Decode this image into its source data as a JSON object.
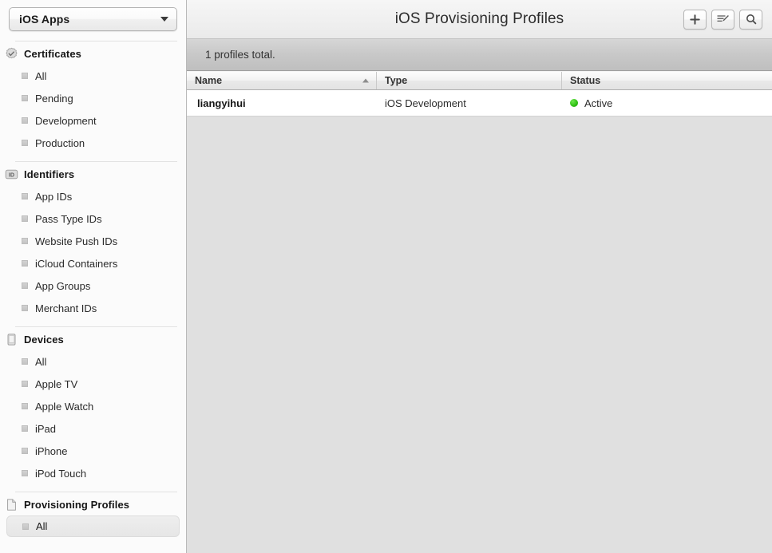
{
  "sidebar": {
    "team_picker": {
      "label": "iOS Apps",
      "chevron_icon": "chevron-down-icon"
    },
    "sections": [
      {
        "id": "certificates",
        "title": "Certificates",
        "icon": "certificate-seal-icon",
        "items": [
          {
            "label": "All",
            "selected": false
          },
          {
            "label": "Pending",
            "selected": false
          },
          {
            "label": "Development",
            "selected": false
          },
          {
            "label": "Production",
            "selected": false
          }
        ]
      },
      {
        "id": "identifiers",
        "title": "Identifiers",
        "icon": "id-badge-icon",
        "items": [
          {
            "label": "App IDs",
            "selected": false
          },
          {
            "label": "Pass Type IDs",
            "selected": false
          },
          {
            "label": "Website Push IDs",
            "selected": false
          },
          {
            "label": "iCloud Containers",
            "selected": false
          },
          {
            "label": "App Groups",
            "selected": false
          },
          {
            "label": "Merchant IDs",
            "selected": false
          }
        ]
      },
      {
        "id": "devices",
        "title": "Devices",
        "icon": "device-phone-icon",
        "items": [
          {
            "label": "All",
            "selected": false
          },
          {
            "label": "Apple TV",
            "selected": false
          },
          {
            "label": "Apple Watch",
            "selected": false
          },
          {
            "label": "iPad",
            "selected": false
          },
          {
            "label": "iPhone",
            "selected": false
          },
          {
            "label": "iPod Touch",
            "selected": false
          }
        ]
      },
      {
        "id": "provisioning-profiles",
        "title": "Provisioning Profiles",
        "icon": "document-page-icon",
        "items": [
          {
            "label": "All",
            "selected": true
          }
        ]
      }
    ]
  },
  "header": {
    "title": "iOS Provisioning Profiles",
    "buttons": [
      {
        "name": "add-button",
        "icon": "plus-icon"
      },
      {
        "name": "edit-button",
        "icon": "edit-list-pencil-icon"
      },
      {
        "name": "search-button",
        "icon": "search-icon"
      }
    ]
  },
  "content": {
    "count_text": "1 profiles total.",
    "columns": [
      {
        "key": "name",
        "label": "Name",
        "sorted": true,
        "sort_direction": "ascending"
      },
      {
        "key": "type",
        "label": "Type",
        "sorted": false
      },
      {
        "key": "status",
        "label": "Status",
        "sorted": false
      }
    ],
    "rows": [
      {
        "name": "liangyihui",
        "type": "iOS Development",
        "status": "Active",
        "status_color": "#2fbf14"
      }
    ]
  }
}
